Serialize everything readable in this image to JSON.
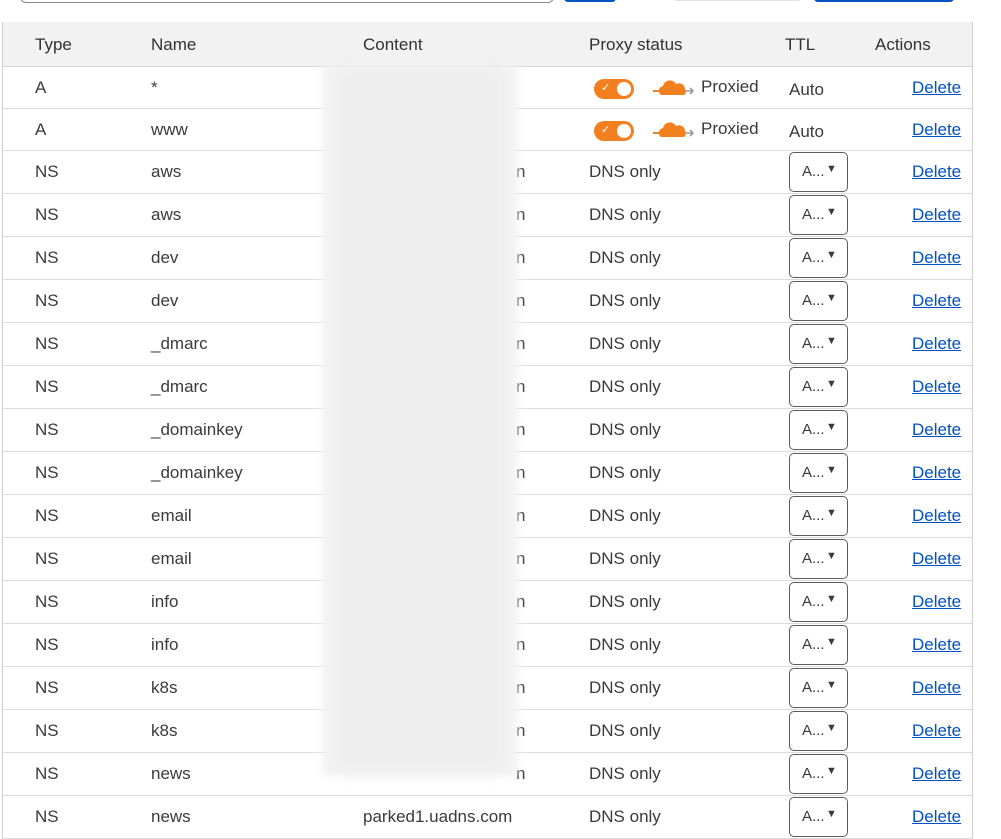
{
  "table": {
    "headers": {
      "type": "Type",
      "name": "Name",
      "content": "Content",
      "proxy": "Proxy status",
      "ttl": "TTL",
      "actions": "Actions"
    },
    "rows": [
      {
        "type": "A",
        "name": "*",
        "content": "",
        "proxy": "Proxied",
        "ttl": "Auto",
        "action": "Delete"
      },
      {
        "type": "A",
        "name": "www",
        "content": "",
        "proxy": "Proxied",
        "ttl": "Auto",
        "action": "Delete"
      },
      {
        "type": "NS",
        "name": "aws",
        "content": "",
        "proxy": "DNS only",
        "ttl": "A...",
        "action": "Delete"
      },
      {
        "type": "NS",
        "name": "aws",
        "content": "",
        "proxy": "DNS only",
        "ttl": "A...",
        "action": "Delete"
      },
      {
        "type": "NS",
        "name": "dev",
        "content": "",
        "proxy": "DNS only",
        "ttl": "A...",
        "action": "Delete"
      },
      {
        "type": "NS",
        "name": "dev",
        "content": "",
        "proxy": "DNS only",
        "ttl": "A...",
        "action": "Delete"
      },
      {
        "type": "NS",
        "name": "_dmarc",
        "content": "",
        "proxy": "DNS only",
        "ttl": "A...",
        "action": "Delete"
      },
      {
        "type": "NS",
        "name": "_dmarc",
        "content": "",
        "proxy": "DNS only",
        "ttl": "A...",
        "action": "Delete"
      },
      {
        "type": "NS",
        "name": "_domainkey",
        "content": "",
        "proxy": "DNS only",
        "ttl": "A...",
        "action": "Delete"
      },
      {
        "type": "NS",
        "name": "_domainkey",
        "content": "",
        "proxy": "DNS only",
        "ttl": "A...",
        "action": "Delete"
      },
      {
        "type": "NS",
        "name": "email",
        "content": "",
        "proxy": "DNS only",
        "ttl": "A...",
        "action": "Delete"
      },
      {
        "type": "NS",
        "name": "email",
        "content": "",
        "proxy": "DNS only",
        "ttl": "A...",
        "action": "Delete"
      },
      {
        "type": "NS",
        "name": "info",
        "content": "",
        "proxy": "DNS only",
        "ttl": "A...",
        "action": "Delete"
      },
      {
        "type": "NS",
        "name": "info",
        "content": "",
        "proxy": "DNS only",
        "ttl": "A...",
        "action": "Delete"
      },
      {
        "type": "NS",
        "name": "k8s",
        "content": "",
        "proxy": "DNS only",
        "ttl": "A...",
        "action": "Delete"
      },
      {
        "type": "NS",
        "name": "k8s",
        "content": "",
        "proxy": "DNS only",
        "ttl": "A...",
        "action": "Delete"
      },
      {
        "type": "NS",
        "name": "news",
        "content": "",
        "proxy": "DNS only",
        "ttl": "A...",
        "action": "Delete"
      },
      {
        "type": "NS",
        "name": "news",
        "content": "parked1.uadns.com",
        "proxy": "DNS only",
        "ttl": "A...",
        "action": "Delete"
      }
    ],
    "partial_suffix": "n"
  },
  "colors": {
    "accent_orange": "#f38020",
    "link_blue": "#0051c3",
    "header_bg": "#f2f2f2"
  },
  "icons": {
    "proxied": "cloud-icon",
    "dropdown": "chevron-down-icon"
  }
}
